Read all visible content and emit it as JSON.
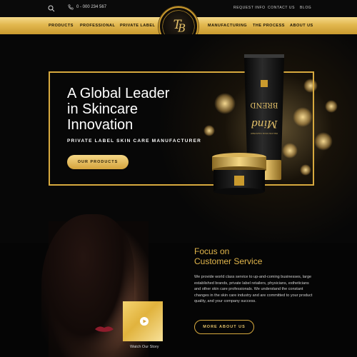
{
  "topbar": {
    "phone": "0 - 000 234 567",
    "links": [
      "REQUEST INFO",
      "CONTACT US",
      "BLOG"
    ]
  },
  "nav": {
    "items": [
      "PRODUCTS",
      "PROFESSIONAL",
      "PRIVATE LABEL",
      "MANUFACTURING",
      "THE PROCESS",
      "ABOUT US"
    ]
  },
  "logo": {
    "sub": "COSMETICS"
  },
  "hero": {
    "title_line1": "A Global Leader",
    "title_line2": "in Skincare",
    "title_line3": "Innovation",
    "subtitle": "PRIVATE LABEL SKIN CARE MANUFACTURER",
    "cta": "OUR PRODUCTS"
  },
  "product": {
    "tube_brand": "BREND",
    "tube_script": "Mind",
    "tube_small": "DELUXE FACE CLEANSER"
  },
  "focus": {
    "title_line1": "Focus on",
    "title_line2": "Customer Service",
    "body": "We provide world class service to up-and-coming businesses, large established brands, private label retailers, physicians, estheticians and other skin care professionals. We understand the constant changes in the skin care industry and are committed to your product quality, and your company success.",
    "cta": "MORE ABOUT US"
  },
  "video": {
    "caption": "Watch Our Story"
  },
  "colors": {
    "gold": "#d7a93e",
    "gold_light": "#f4d98a",
    "background": "#0b0b0b"
  }
}
